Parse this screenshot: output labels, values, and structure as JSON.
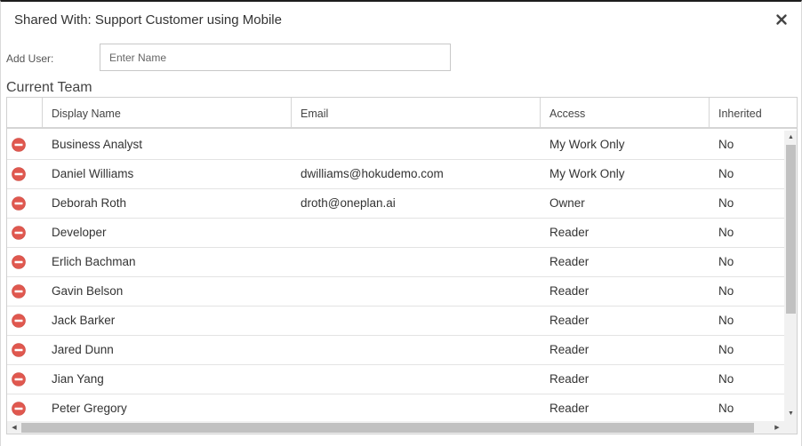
{
  "dialog": {
    "title": "Shared With: Support Customer using Mobile",
    "close_icon": "close-x-icon"
  },
  "add_user": {
    "label": "Add User:",
    "placeholder": "Enter Name",
    "value": ""
  },
  "team": {
    "title": "Current Team",
    "columns": [
      "",
      "Display Name",
      "Email",
      "Access",
      "Inherited"
    ],
    "remove_icon": "remove-circle-icon",
    "remove_icon_color": "#e0584f",
    "rows": [
      {
        "name": "Business Analyst",
        "email": "",
        "access": "My Work Only",
        "inherited": "No"
      },
      {
        "name": "Daniel Williams",
        "email": "dwilliams@hokudemo.com",
        "access": "My Work Only",
        "inherited": "No"
      },
      {
        "name": "Deborah Roth",
        "email": "droth@oneplan.ai",
        "access": "Owner",
        "inherited": "No"
      },
      {
        "name": "Developer",
        "email": "",
        "access": "Reader",
        "inherited": "No"
      },
      {
        "name": "Erlich Bachman",
        "email": "",
        "access": "Reader",
        "inherited": "No"
      },
      {
        "name": "Gavin Belson",
        "email": "",
        "access": "Reader",
        "inherited": "No"
      },
      {
        "name": "Jack Barker",
        "email": "",
        "access": "Reader",
        "inherited": "No"
      },
      {
        "name": "Jared Dunn",
        "email": "",
        "access": "Reader",
        "inherited": "No"
      },
      {
        "name": "Jian Yang",
        "email": "",
        "access": "Reader",
        "inherited": "No"
      },
      {
        "name": "Peter Gregory",
        "email": "",
        "access": "Reader",
        "inherited": "No"
      }
    ]
  },
  "scrollbars": {
    "up_icon": "scroll-up-arrow-icon",
    "down_icon": "scroll-down-arrow-icon",
    "left_icon": "scroll-left-arrow-icon",
    "right_icon": "scroll-right-arrow-icon"
  }
}
